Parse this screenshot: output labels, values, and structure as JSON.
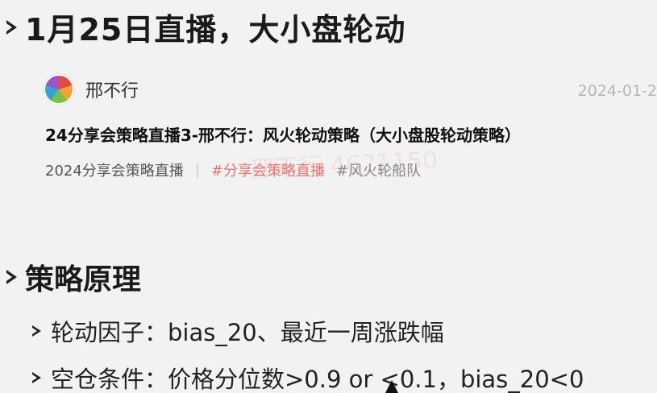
{
  "slide_title": "1月25日直播，大小盘轮动",
  "card": {
    "author": "邢不行",
    "date": "2024-01-2",
    "title": "24分享会策略直播3-邢不行：风火轮动策略（大小盘股轮动策略）",
    "tags": {
      "category": "2024分享会策略直播",
      "separator": "|",
      "topic": "#分享会策略直播",
      "series": "#风火轮船队"
    },
    "watermark": "邢不行 4621150"
  },
  "section_title": "策略原理",
  "bullets": [
    "轮动因子：bias_20、最近一周涨跌幅",
    "空仓条件：价格分位数>0.9 or <0.1，bias_20<0"
  ]
}
